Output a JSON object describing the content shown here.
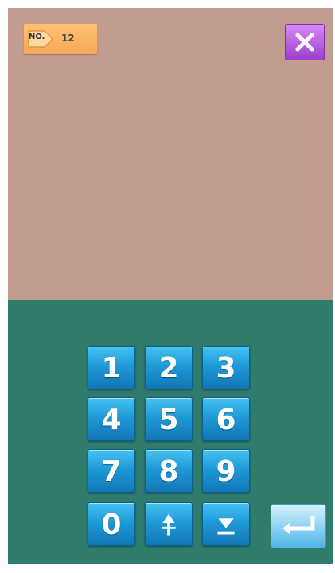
{
  "header": {
    "no_label": "NO.",
    "no_value": "12"
  },
  "icons": {
    "close": "close-icon",
    "up": "up-arrow-icon",
    "down": "down-arrow-icon",
    "enter": "enter-icon",
    "tag": "tag-icon"
  },
  "keypad": {
    "keys": [
      "1",
      "2",
      "3",
      "4",
      "5",
      "6",
      "7",
      "8",
      "9",
      "0"
    ]
  },
  "colors": {
    "top_panel": "#c29c90",
    "bottom_panel": "#2f7b6c",
    "key_blue": "#1f9ad8",
    "close_purple": "#b35fe0",
    "badge_orange": "#f7a855"
  }
}
